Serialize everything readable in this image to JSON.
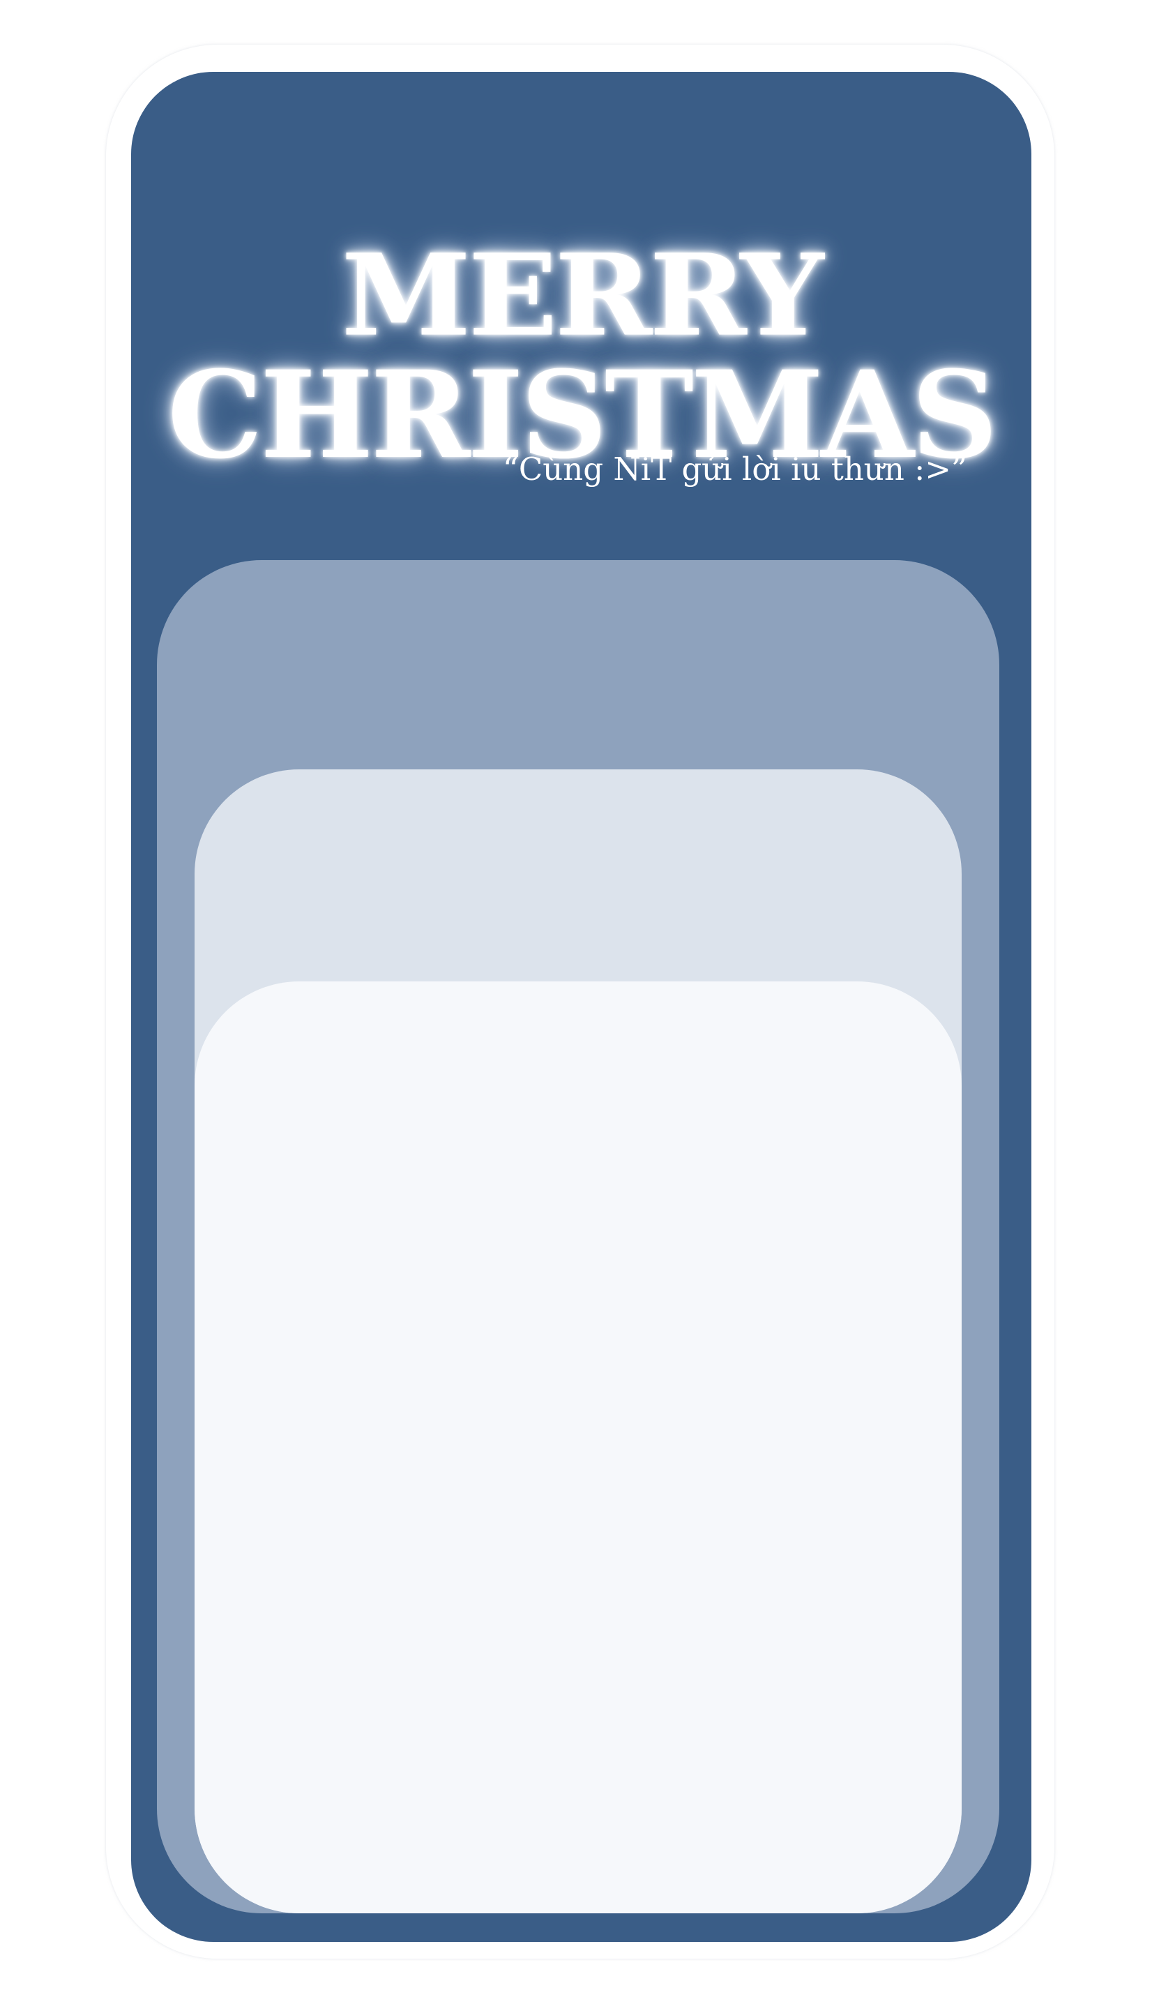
{
  "greeting": {
    "title_line_1": "MERRY",
    "title_line_2": "CHRISTMAS",
    "subtitle": "“Cùng NiT gửi lời iu thưn :>”"
  },
  "colors": {
    "card_background": "#3a5d87",
    "panel_back": "#8ea2bd",
    "panel_middle": "#dce3ec",
    "panel_front": "#f6f8fb",
    "text": "#ffffff"
  }
}
